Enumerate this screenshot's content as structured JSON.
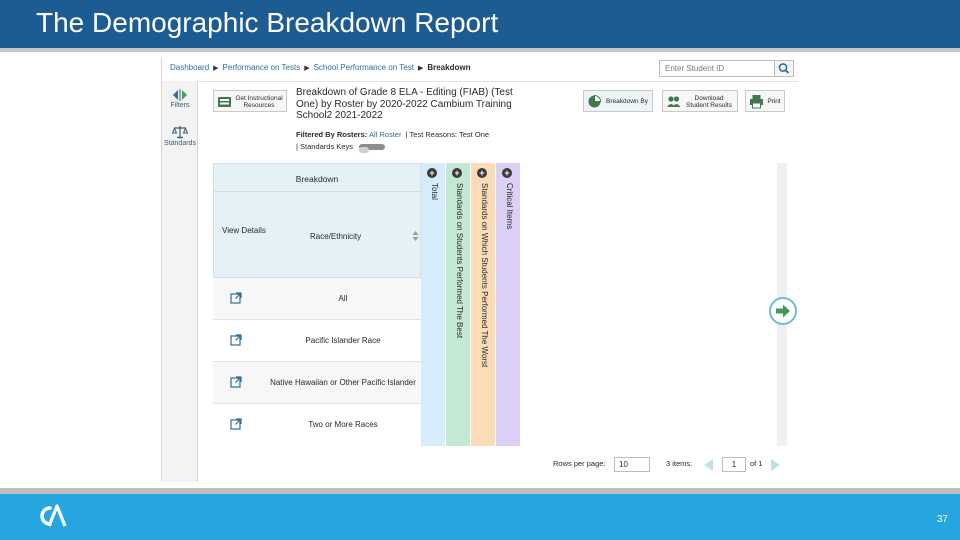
{
  "slide": {
    "title": "The Demographic Breakdown Report",
    "page_number": "37",
    "colors": {
      "header": "#1d5b93",
      "footer": "#26a6de"
    }
  },
  "rail": {
    "filters_label": "Filters",
    "standards_label": "Standards"
  },
  "breadcrumb": {
    "dashboard": "Dashboard",
    "performance_on_tests": "Performance on Tests",
    "school_performance": "School Performance on Test",
    "current": "Breakdown"
  },
  "search": {
    "placeholder": "Enter Student ID"
  },
  "toolbar": {
    "instructional_resources": "Get Instructional Resources",
    "breakdown_by": "Breakdown By",
    "download_results": "Download Student Results",
    "print": "Print"
  },
  "report": {
    "title": "Breakdown of Grade 8 ELA - Editing (FIAB) (Test One) by Roster by 2020-2022 Cambium Training School2 2021-2022",
    "filters_by_rosters_label": "Filtered By Rosters:",
    "filters_by_rosters_value": "All Roster",
    "test_reasons_label": "| Test Reasons:",
    "test_reasons_value": "Test One",
    "standards_keys_label": "| Standards Keys"
  },
  "table": {
    "group_header": "Breakdown",
    "view_details_header": "View Details",
    "race_header": "Race/Ethnicity",
    "rows": [
      {
        "label": "All"
      },
      {
        "label": "Pacific Islander Race"
      },
      {
        "label": "Native Hawaiian or Other Pacific Islander"
      },
      {
        "label": "Two or More Races"
      }
    ],
    "rotated_columns": [
      {
        "label": "Total",
        "color": "#d6ecfb"
      },
      {
        "label": "Standards on Students Performed The Best",
        "color": "#c3e8d3"
      },
      {
        "label": "Standards on Which Students Performed The Worst",
        "color": "#fbdcb6"
      },
      {
        "label": "Critical Items",
        "color": "#dccff5"
      }
    ]
  },
  "pagination": {
    "rows_per_page_label": "Rows per page:",
    "rows_per_page_value": "10",
    "items_label": "3 items:",
    "page_value": "1",
    "of_label": "of 1"
  }
}
